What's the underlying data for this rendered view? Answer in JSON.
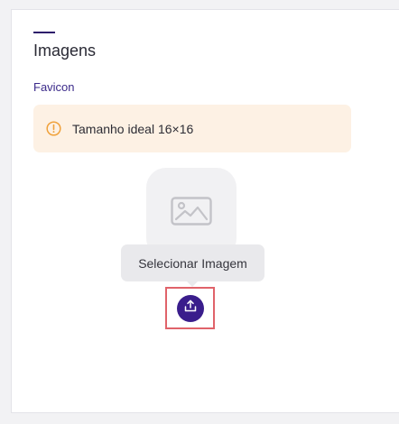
{
  "section": {
    "title": "Imagens",
    "field_label": "Favicon"
  },
  "alert": {
    "icon": "warning-circle-icon",
    "text": "Tamanho ideal 16×16",
    "background": "#fdf1e4",
    "icon_color": "#f0a13a"
  },
  "placeholder": {
    "icon": "image-icon"
  },
  "tooltip": {
    "text": "Selecionar Imagem"
  },
  "upload_button": {
    "icon": "upload-icon",
    "color": "#3a1d8c",
    "highlight_color": "#e0636a"
  }
}
